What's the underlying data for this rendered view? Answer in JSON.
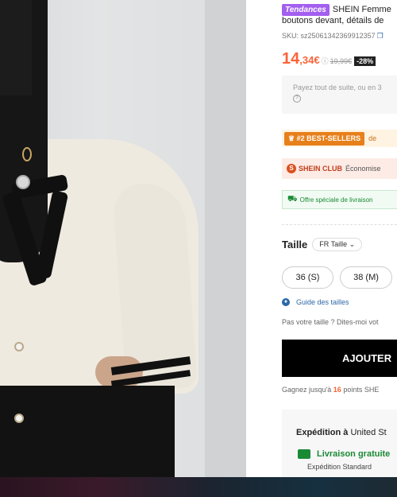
{
  "product": {
    "trend_badge": "Tendances",
    "title_line1": "SHEIN Femme",
    "title_line2": "boutons devant, détails de",
    "sku": "SKU: sz25061342369912357",
    "price_main": "14",
    "price_cents": ",34€",
    "old_price": "19,99€",
    "discount": "-28%"
  },
  "payment": {
    "text": "Payez tout de suite, ou en 3"
  },
  "badges": {
    "bestseller": "#2 BEST-SELLERS",
    "bestseller_suffix": "de",
    "club_name": "SHEIN CLUB",
    "club_text": "Économise",
    "offer": "Offre spéciale de livraison"
  },
  "size": {
    "label": "Taille",
    "selector": "FR Taille",
    "options": [
      "36 (S)",
      "38 (M)"
    ],
    "guide": "Guide des tailles",
    "no_size": "Pas votre taille ? Dites-moi vot"
  },
  "cart": {
    "add_button": "AJOUTER"
  },
  "points": {
    "prefix": "Gagnez jusqu'à",
    "value": "16",
    "suffix": "points SHE"
  },
  "shipping": {
    "title_bold": "Expédition à",
    "title_rest": "United St",
    "free": "Livraison gratuite",
    "standard": "Expédition Standard"
  },
  "colors": {
    "price": "#fa6338",
    "trend": "#a35ff0",
    "green": "#1a8a35"
  }
}
